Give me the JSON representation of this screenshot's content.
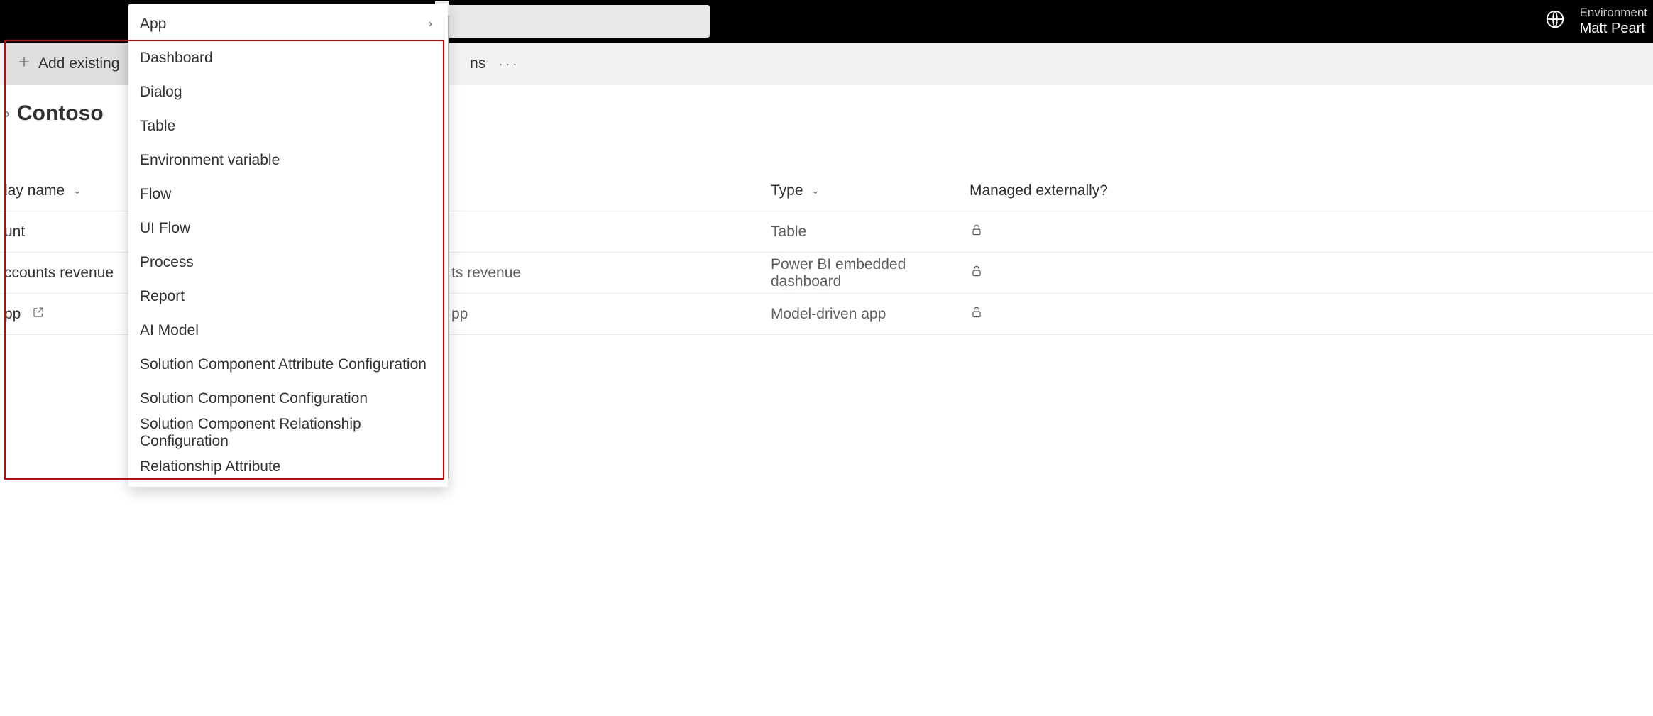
{
  "header": {
    "environment_label": "Environment",
    "environment_name": "Matt Peart"
  },
  "commandbar": {
    "add_existing_label": "Add existing",
    "truncated_cmd_suffix": "ns"
  },
  "breadcrumb": {
    "solution_name": "Contoso"
  },
  "table": {
    "columns": {
      "display_name": "lay name",
      "name_fragment": "ts revenue",
      "type": "Type",
      "managed_externally": "Managed externally?"
    },
    "rows": [
      {
        "display_name": "unt",
        "name": "",
        "type": "Table"
      },
      {
        "display_name": "ccounts revenue",
        "name": "ts revenue",
        "type": "Power BI embedded dashboard"
      },
      {
        "display_name": "pp",
        "name": "pp",
        "type": "Model-driven app",
        "has_ext_icon": true
      }
    ]
  },
  "dropdown": {
    "items": [
      {
        "label": "App",
        "has_submenu": true
      },
      {
        "label": "Dashboard"
      },
      {
        "label": "Dialog"
      },
      {
        "label": "Table"
      },
      {
        "label": "Environment variable"
      },
      {
        "label": "Flow"
      },
      {
        "label": "UI Flow"
      },
      {
        "label": "Process"
      },
      {
        "label": "Report"
      },
      {
        "label": "AI Model"
      },
      {
        "label": "Solution Component Attribute Configuration"
      },
      {
        "label": "Solution Component Configuration"
      },
      {
        "label": "Solution Component Relationship Configuration"
      },
      {
        "label": "Relationship Attribute"
      }
    ]
  }
}
